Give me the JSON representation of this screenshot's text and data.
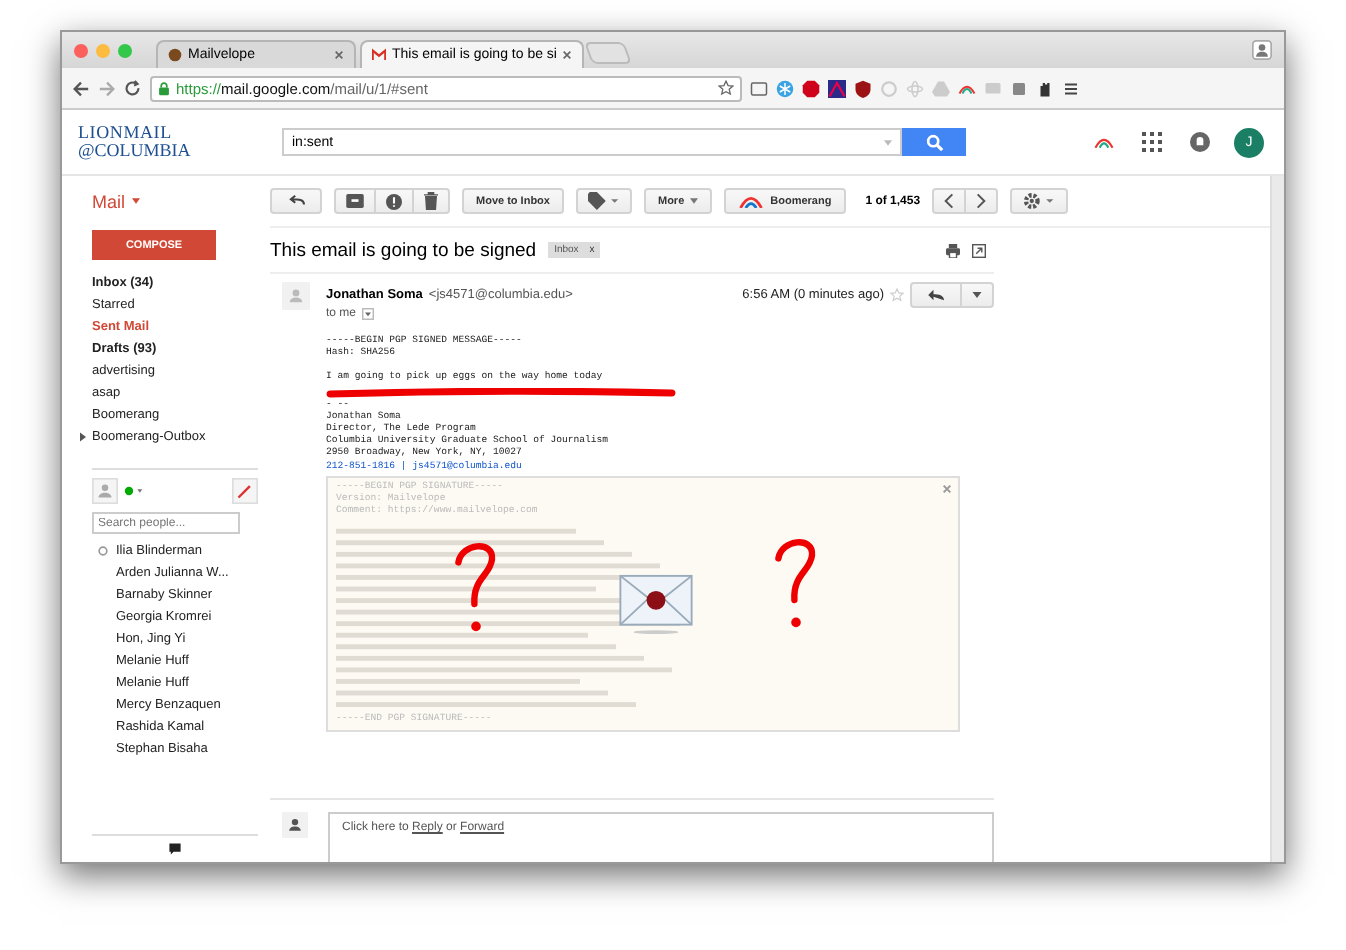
{
  "browser": {
    "tabs": [
      {
        "title": "Mailvelope",
        "selected": false,
        "kind": "site"
      },
      {
        "title": "This email is going to be si",
        "selected": true,
        "kind": "gmail"
      }
    ],
    "url": {
      "scheme": "https://",
      "host": "mail.google.com",
      "path": "/mail/u/1/#sent"
    }
  },
  "header": {
    "logo": [
      "LIONMAIL",
      "@COLUMBIA"
    ],
    "search": "in:sent",
    "avatar": "J"
  },
  "sidebar": {
    "title": "Mail",
    "compose": "COMPOSE",
    "folders": [
      {
        "label": "Inbox (34)",
        "selected": false,
        "unread": true,
        "expandable": false
      },
      {
        "label": "Starred",
        "selected": false,
        "unread": false,
        "expandable": false
      },
      {
        "label": "Sent Mail",
        "selected": true,
        "unread": false,
        "expandable": false
      },
      {
        "label": "Drafts (93)",
        "selected": false,
        "unread": true,
        "expandable": false
      },
      {
        "label": "advertising",
        "selected": false,
        "unread": false,
        "expandable": false
      },
      {
        "label": "asap",
        "selected": false,
        "unread": false,
        "expandable": false
      },
      {
        "label": "Boomerang",
        "selected": false,
        "unread": false,
        "expandable": false
      },
      {
        "label": "Boomerang-Outbox",
        "selected": false,
        "unread": false,
        "expandable": true
      }
    ],
    "people_placeholder": "Search people...",
    "contacts": [
      {
        "name": "Ilia Blinderman",
        "status": true
      },
      {
        "name": "Arden Julianna W...",
        "status": false
      },
      {
        "name": "Barnaby Skinner",
        "status": false
      },
      {
        "name": "Georgia Kromrei",
        "status": false
      },
      {
        "name": "Hon, Jing Yi",
        "status": false
      },
      {
        "name": "Melanie Huff",
        "status": false
      },
      {
        "name": "Melanie Huff",
        "status": false
      },
      {
        "name": "Mercy Benzaquen",
        "status": false
      },
      {
        "name": "Rashida Kamal",
        "status": false
      },
      {
        "name": "Stephan Bisaha",
        "status": false
      }
    ]
  },
  "toolbar": {
    "move": "Move to Inbox",
    "more": "More",
    "boomerang": "Boomerang",
    "count": "1 of 1,453"
  },
  "email": {
    "subject": "This email is going to be signed",
    "label": "Inbox",
    "label_close": "x",
    "sender": "Jonathan Soma",
    "address": "<js4571@columbia.edu>",
    "recipient": "to me",
    "time": "6:56 AM (0 minutes ago)",
    "header_lines": [
      "-----BEGIN PGP SIGNED MESSAGE-----",
      "Hash: SHA256"
    ],
    "message": "I am going to pick up eggs on the way home today",
    "signature_lines": [
      "- --",
      "Jonathan Soma",
      "Director, The Lede Program",
      "Columbia University Graduate School of Journalism",
      "2950 Broadway, New York, NY, 10027"
    ],
    "contact_link": "212-851-1816 | js4571@columbia.edu",
    "pgp": {
      "top_lines": [
        "-----BEGIN PGP SIGNATURE-----",
        "Version: Mailvelope",
        "Comment: https://www.mailvelope.com"
      ],
      "end_line": "-----END PGP SIGNATURE-----"
    }
  },
  "reply": {
    "prefix": "Click here to",
    "reply": "Reply",
    "joiner": "or",
    "forward": "Forward"
  }
}
